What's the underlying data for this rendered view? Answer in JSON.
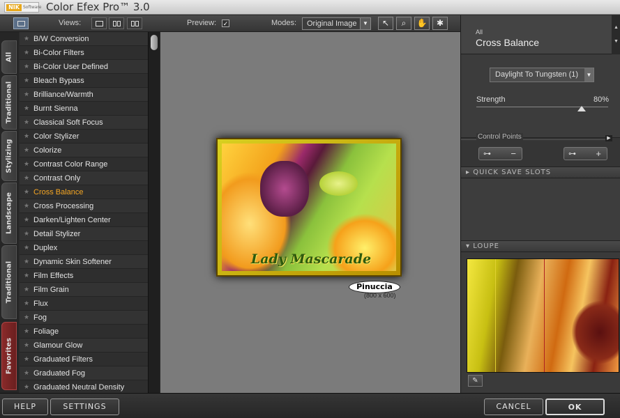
{
  "window": {
    "logo_text": "NIK",
    "logo_sub": "Software",
    "title": "Color Efex Pro™ 3.0"
  },
  "toolbar": {
    "views_label": "Views:",
    "preview_label": "Preview:",
    "preview_checked": true,
    "modes_label": "Modes:",
    "mode_value": "Original Image",
    "tools": [
      "pointer-icon",
      "zoom-icon",
      "hand-icon",
      "light-icon"
    ]
  },
  "vertical_tabs": [
    "All",
    "Traditional",
    "Stylizing",
    "Landscape",
    "Traditional",
    "Favorites"
  ],
  "filters": [
    "B/W Conversion",
    "Bi-Color Filters",
    "Bi-Color User Defined",
    "Bleach Bypass",
    "Brilliance/Warmth",
    "Burnt Sienna",
    "Classical Soft Focus",
    "Color Stylizer",
    "Colorize",
    "Contrast Color Range",
    "Contrast Only",
    "Cross Balance",
    "Cross Processing",
    "Darken/Lighten Center",
    "Detail Stylizer",
    "Duplex",
    "Dynamic Skin Softener",
    "Film Effects",
    "Film Grain",
    "Flux",
    "Fog",
    "Foliage",
    "Glamour Glow",
    "Graduated Filters",
    "Graduated Fog",
    "Graduated Neutral Density"
  ],
  "active_filter_index": 11,
  "preview": {
    "art_title": "Lady Mascarade",
    "watermark": "Pinuccia",
    "size_label": "(800 x 600)"
  },
  "panel": {
    "category": "All",
    "filter_name": "Cross Balance",
    "preset": "Daylight To Tungsten (1)",
    "strength_label": "Strength",
    "strength_value": "80%",
    "strength": 80,
    "control_points_label": "Control Points",
    "cp_minus": "−",
    "cp_plus": "+",
    "quick_save_label": "QUICK SAVE SLOTS",
    "loupe_label": "LOUPE"
  },
  "buttons": {
    "help": "HELP",
    "settings": "SETTINGS",
    "cancel": "CANCEL",
    "ok": "OK"
  },
  "colors": {
    "accent": "#f5a623",
    "favorites": "#8a2a2a"
  }
}
